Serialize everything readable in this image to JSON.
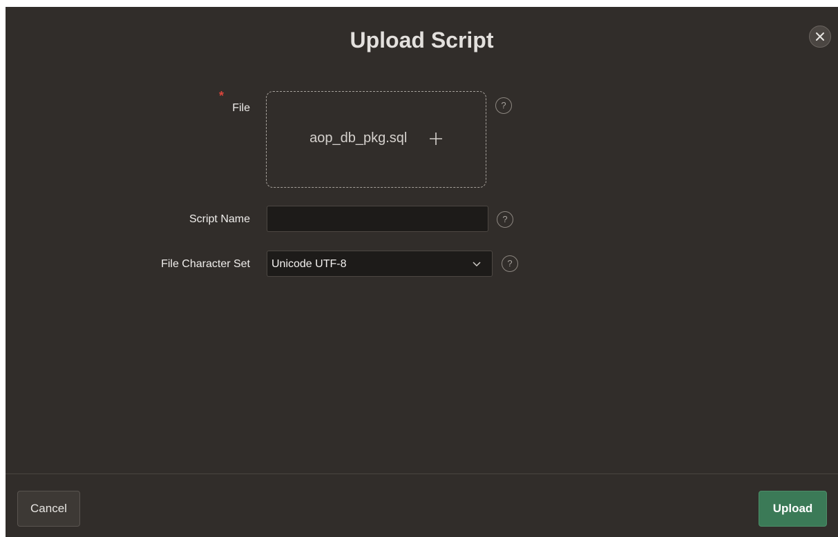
{
  "dialog": {
    "title": "Upload Script",
    "close_icon": "close-icon"
  },
  "form": {
    "file": {
      "label": "File",
      "required_marker": "*",
      "selected_file": "aop_db_pkg.sql",
      "add_icon": "plus-icon",
      "help_text": "?"
    },
    "script_name": {
      "label": "Script Name",
      "value": "",
      "help_text": "?"
    },
    "charset": {
      "label": "File Character Set",
      "selected": "Unicode UTF-8",
      "dropdown_icon": "chevron-down-icon",
      "help_text": "?"
    }
  },
  "footer": {
    "cancel_label": "Cancel",
    "upload_label": "Upload"
  },
  "colors": {
    "dialog_bg": "#312d2a",
    "input_bg": "#1d1b19",
    "primary": "#3b7a57",
    "required": "#d9453b"
  }
}
